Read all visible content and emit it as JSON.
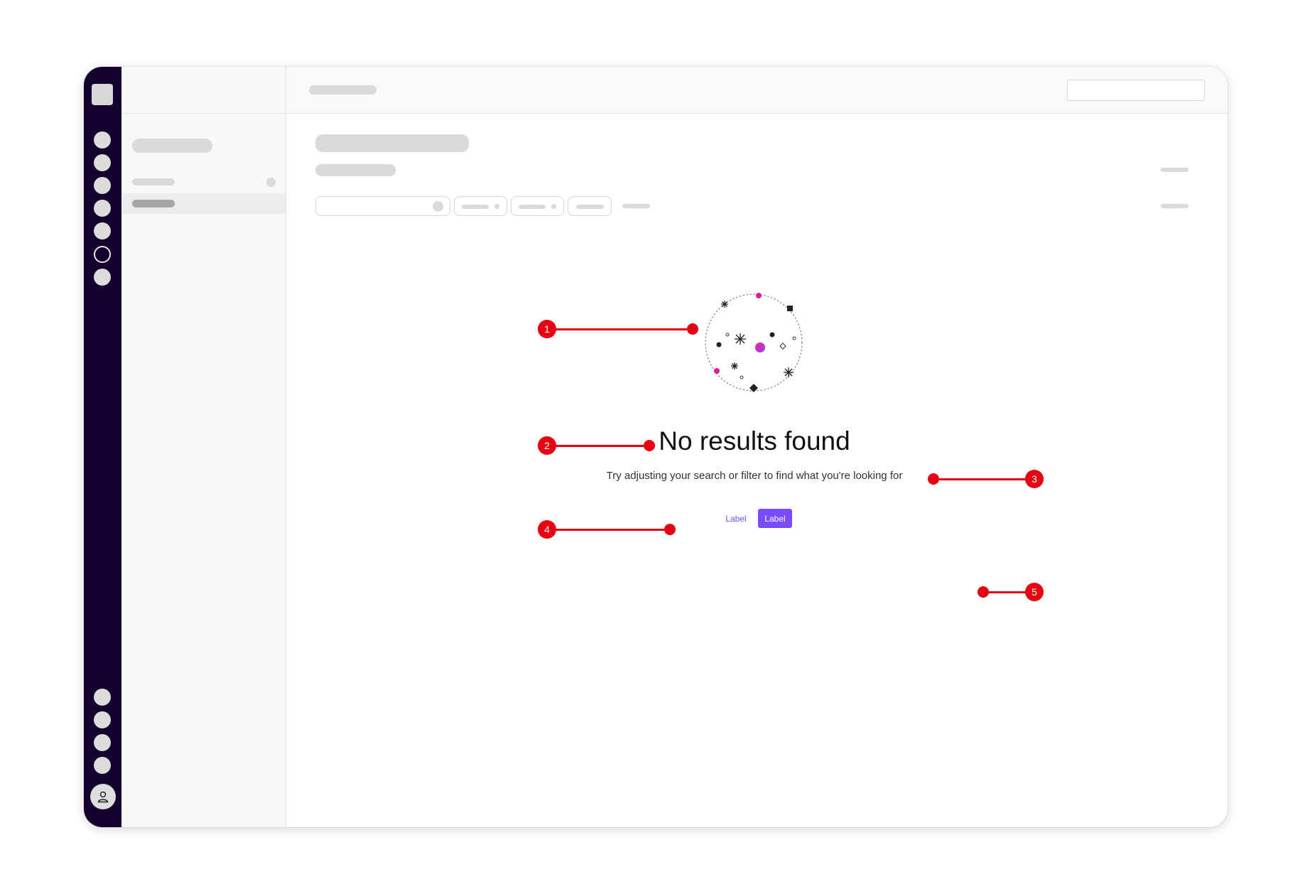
{
  "empty_state": {
    "title": "No results found",
    "description": "Try adjusting your search or filter to find what you're looking for",
    "secondary_button": "Label",
    "primary_button": "Label"
  },
  "annotations": [
    "1",
    "2",
    "3",
    "4",
    "5"
  ],
  "colors": {
    "rail": "#13002c",
    "accent": "#7a4bff",
    "annotation": "#e60012",
    "gradient_start": "#ff1e8c",
    "gradient_end": "#8a46ff"
  },
  "icons": {
    "avatar": "user-icon"
  }
}
